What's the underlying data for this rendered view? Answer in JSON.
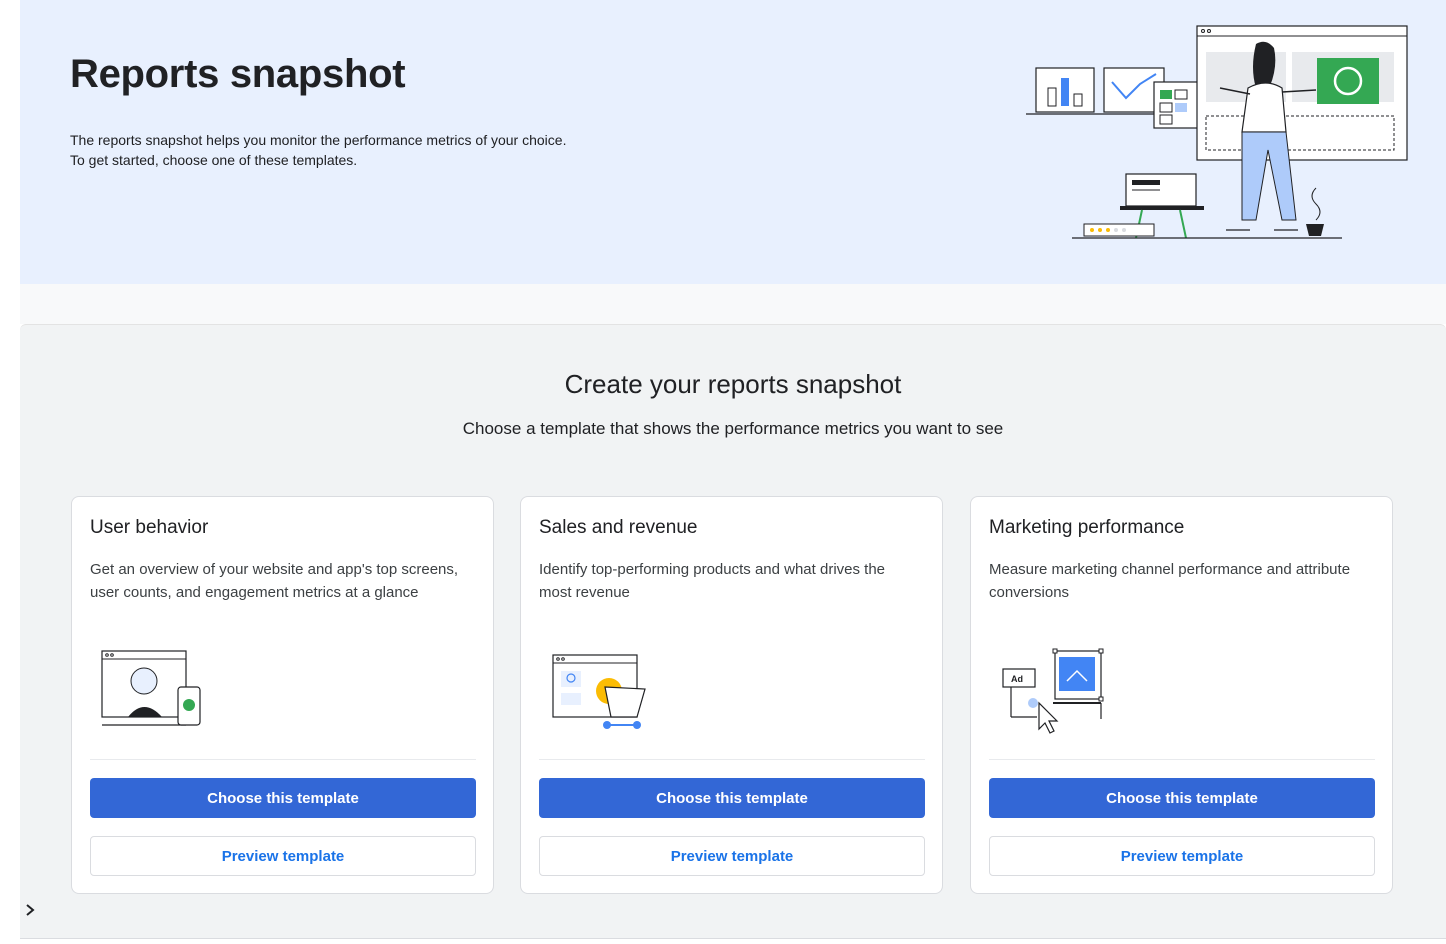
{
  "hero": {
    "title": "Reports snapshot",
    "desc_line1": "The reports snapshot helps you monitor the performance metrics of your choice.",
    "desc_line2": "To get started, choose one of these templates.",
    "illustration": "person-presenting-dashboard-illustration"
  },
  "main": {
    "title": "Create your reports snapshot",
    "subtitle": "Choose a template that shows the performance metrics you want to see"
  },
  "cards": [
    {
      "title": "User behavior",
      "description": "Get an overview of your website and app's top screens, user counts, and engagement metrics at a glance",
      "illustration": "monitor-and-phone-illustration",
      "choose_label": "Choose this template",
      "preview_label": "Preview template"
    },
    {
      "title": "Sales and revenue",
      "description": "Identify top-performing products and what drives the most revenue",
      "illustration": "browser-and-shopping-cart-illustration",
      "choose_label": "Choose this template",
      "preview_label": "Preview template"
    },
    {
      "title": "Marketing performance",
      "description": "Measure marketing channel performance and attribute conversions",
      "illustration": "ad-and-cursor-illustration",
      "ad_badge": "Ad",
      "choose_label": "Choose this template",
      "preview_label": "Preview template"
    }
  ],
  "expand_icon": "chevron-right-icon",
  "colors": {
    "hero_bg": "#e8f0fe",
    "primary_button": "#3367d6",
    "link_text": "#1a73e8",
    "green_accent": "#34a853",
    "yellow_accent": "#fbbc04"
  }
}
